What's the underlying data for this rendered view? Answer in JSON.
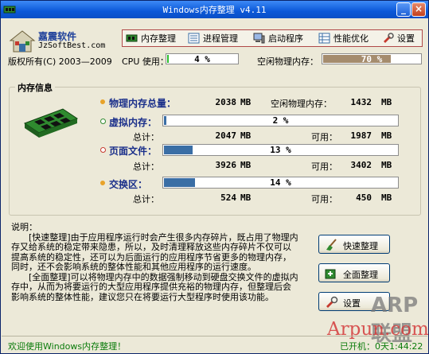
{
  "window": {
    "title": "Windows内存整理 v4.11",
    "minimize": "_",
    "close": "×"
  },
  "logo": {
    "name": "嘉震软件",
    "url": "JzSoftBest.com"
  },
  "copyright": "版权所有(C) 2003—2009",
  "toolbar": {
    "items": [
      "内存整理",
      "进程管理",
      "启动程序",
      "性能优化",
      "设置"
    ]
  },
  "cpu": {
    "label": "CPU 使用：",
    "value": "4 %",
    "percent": 4
  },
  "free_physical": {
    "label": "空闲物理内存：",
    "value": "70 %",
    "percent": 70
  },
  "memory_info": {
    "title": "内存信息",
    "physical": {
      "label": "物理内存总量：",
      "value": "2038",
      "unit": "MB",
      "free_label": "空闲物理内存：",
      "free_value": "1432",
      "free_unit": "MB"
    },
    "virtual": {
      "label": "虚拟内存：",
      "bar_text": "2 %",
      "percent": 2,
      "total_label": "总计：",
      "total_value": "2047",
      "total_unit": "MB",
      "avail_label": "可用：",
      "avail_value": "1987",
      "avail_unit": "MB"
    },
    "pagefile": {
      "label": "页面文件：",
      "bar_text": "13 %",
      "percent": 13,
      "total_label": "总计：",
      "total_value": "3926",
      "total_unit": "MB",
      "avail_label": "可用：",
      "avail_value": "3402",
      "avail_unit": "MB"
    },
    "swap": {
      "label": "交换区：",
      "bar_text": "14 %",
      "percent": 14,
      "total_label": "总计：",
      "total_value": "524",
      "total_unit": "MB",
      "avail_label": "可用：",
      "avail_value": "450",
      "avail_unit": "MB"
    }
  },
  "description": {
    "title": "说明：",
    "p1": "　　[快速整理]由于应用程序运行时会产生很多内存碎片，既占用了物理内存又给系统的稳定带来隐患，所以，及时清理释放这些内存碎片不仅可以提高系统的稳定性，还可以为后面运行的应用程序节省更多的物理内存，同时，还不会影响系统的整体性能和其他应用程序的运行速度。",
    "p2": "　　[全面整理]可以将物理内存中的数据强制移动到硬盘交换文件的虚拟内存中，从而为将要运行的大型应用程序提供充裕的物理内存，但整理后会影响系统的整体性能，建议您只在将要运行大型程序时使用该功能。"
  },
  "buttons": {
    "quick": "快速整理",
    "full": "全面整理",
    "settings": "设置"
  },
  "watermark": {
    "brand": "ARP联盟",
    "url": "Arpun.com"
  },
  "status": {
    "left": "欢迎使用Windows内存整理！",
    "right": "已开机：0天1:44:22"
  },
  "colors": {
    "bar_fill": "#3a6ea5",
    "free_fill": "#a58c6e",
    "cpu_fill": "#2dbf2d",
    "title_blue": "#1a2f8a"
  }
}
